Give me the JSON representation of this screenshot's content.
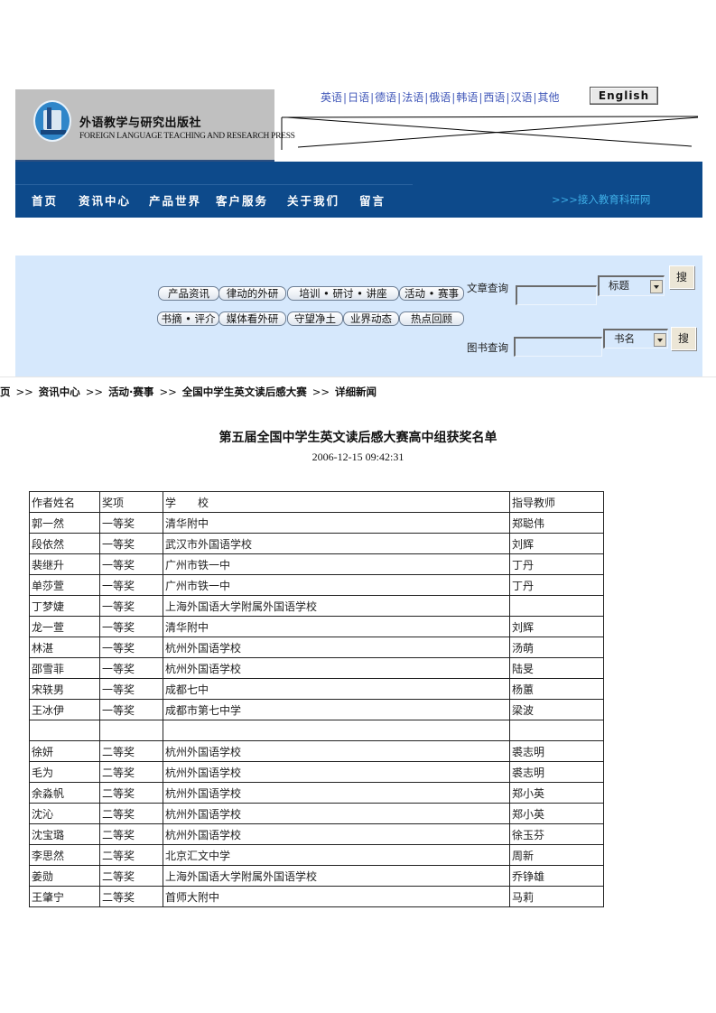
{
  "header": {
    "logo_cn": "外语教学与研究出版社",
    "logo_en": "FOREIGN LANGUAGE TEACHING AND RESEARCH PRESS",
    "languages": [
      "英语",
      "日语",
      "德语",
      "法语",
      "俄语",
      "韩语",
      "西语",
      "汉语",
      "其他"
    ],
    "english_button": "English"
  },
  "nav": {
    "items": [
      "首页",
      "资讯中心",
      "产品世界",
      "客户服务",
      "关于我们",
      "留言"
    ],
    "external_link": ">>>接入教育科研网",
    "external_color": "#3fb0e8",
    "bar_color": "#0d4a8b"
  },
  "panel": {
    "categories_row1": [
      "产品资讯",
      "律动的外研",
      "培训 • 研讨 • 讲座",
      "活动 • 赛事"
    ],
    "categories_row2": [
      "书摘 • 评介",
      "媒体看外研",
      "守望净土",
      "业界动态",
      "热点回顾"
    ],
    "article_search": {
      "label": "文章查询",
      "value": "",
      "select_value": "标题",
      "button": "搜"
    },
    "book_search": {
      "label": "图书查询",
      "value": "",
      "select_value": "书名",
      "button": "搜"
    },
    "background": "#d6e8fc"
  },
  "breadcrumb": [
    "页",
    "资讯中心",
    "活动·赛事",
    "全国中学生英文读后感大赛",
    "详细新闻"
  ],
  "breadcrumb_separator": ">>",
  "article": {
    "title": "第五届全国中学生英文读后感大赛高中组获奖名单",
    "date": "2006-12-15 09:42:31"
  },
  "table": {
    "headers": [
      "作者姓名",
      "奖项",
      "学　　校",
      "指导教师"
    ],
    "rows": [
      [
        "郭一然",
        "一等奖",
        "清华附中",
        "郑聪伟"
      ],
      [
        "段依然",
        "一等奖",
        "武汉市外国语学校",
        "刘辉"
      ],
      [
        "裴继升",
        "一等奖",
        "广州市铁一中",
        "丁丹"
      ],
      [
        "单莎萱",
        "一等奖",
        "广州市铁一中",
        "丁丹"
      ],
      [
        "丁梦婕",
        "一等奖",
        "上海外国语大学附属外国语学校",
        ""
      ],
      [
        "龙一萱",
        "一等奖",
        "清华附中",
        "刘辉"
      ],
      [
        "林湛",
        "一等奖",
        "杭州外国语学校",
        "汤萌"
      ],
      [
        "邵雪菲",
        "一等奖",
        "杭州外国语学校",
        "陆旻"
      ],
      [
        "宋轶男",
        "一等奖",
        "成都七中",
        "杨蕙"
      ],
      [
        "王冰伊",
        "一等奖",
        "成都市第七中学",
        "梁波"
      ],
      [
        "",
        "",
        "",
        ""
      ],
      [
        "徐妍",
        "二等奖",
        "杭州外国语学校",
        "裘志明"
      ],
      [
        "毛为",
        "二等奖",
        "杭州外国语学校",
        "裘志明"
      ],
      [
        "余淼帆",
        "二等奖",
        "杭州外国语学校",
        "郑小英"
      ],
      [
        "沈沁",
        "二等奖",
        "杭州外国语学校",
        "郑小英"
      ],
      [
        "沈宝璐",
        "二等奖",
        "杭州外国语学校",
        "徐玉芬"
      ],
      [
        "李思然",
        "二等奖",
        "北京汇文中学",
        "周新"
      ],
      [
        "姜勋",
        "二等奖",
        "上海外国语大学附属外国语学校",
        "乔铮雄"
      ],
      [
        "王肇宁",
        "二等奖",
        "首师大附中",
        "马莉"
      ]
    ]
  }
}
